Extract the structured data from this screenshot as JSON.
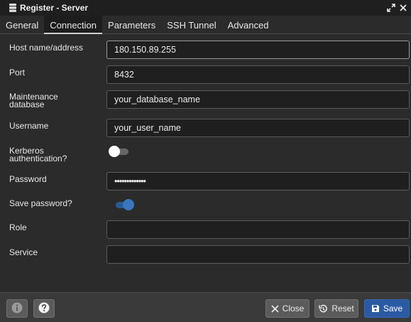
{
  "window": {
    "title": "Register - Server",
    "icons": {
      "title": "server-icon",
      "expand": "expand-icon",
      "close": "close-icon"
    }
  },
  "tabs": [
    {
      "label": "General"
    },
    {
      "label": "Connection",
      "active": true
    },
    {
      "label": "Parameters"
    },
    {
      "label": "SSH Tunnel"
    },
    {
      "label": "Advanced"
    }
  ],
  "form": {
    "host": {
      "label": "Host name/address",
      "value": "180.150.89.255"
    },
    "port": {
      "label": "Port",
      "value": "8432"
    },
    "maintenance_db": {
      "label_line1": "Maintenance",
      "label_line2": "database",
      "value": "your_database_name"
    },
    "username": {
      "label": "Username",
      "value": "your_user_name"
    },
    "kerberos": {
      "label_line1": "Kerberos",
      "label_line2": "authentication?",
      "enabled": false
    },
    "password": {
      "label": "Password",
      "value": "•••••••••••••"
    },
    "save_password": {
      "label": "Save password?",
      "enabled": true
    },
    "role": {
      "label": "Role",
      "value": ""
    },
    "service": {
      "label": "Service",
      "value": ""
    }
  },
  "footer": {
    "info_icon": "info-icon",
    "help_icon": "help-icon",
    "close_label": "Close",
    "reset_label": "Reset",
    "save_label": "Save"
  },
  "colors": {
    "accent": "#2b5aa3",
    "toggle_on": "#2a5a93",
    "background": "#2b2b2b",
    "input_bg": "#1f1f1f"
  }
}
